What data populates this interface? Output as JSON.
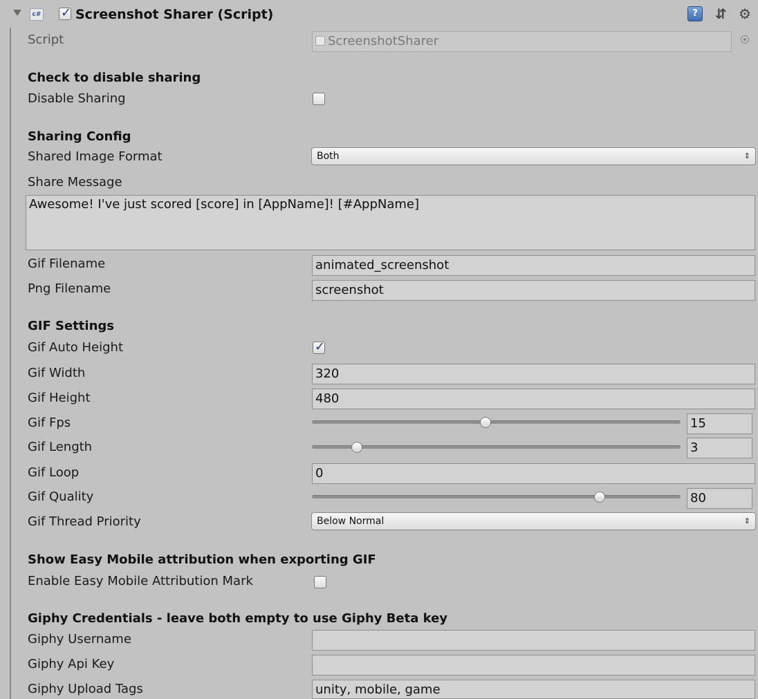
{
  "header": {
    "title": "Screenshot Sharer (Script)",
    "icon": "csharp-script-icon",
    "enabled": true
  },
  "script": {
    "label": "Script",
    "value": "ScreenshotSharer"
  },
  "sections": {
    "disable": "Check to disable sharing",
    "sharing": "Sharing Config",
    "gif": "GIF Settings",
    "attribution": "Show Easy Mobile attribution when exporting GIF",
    "giphy": "Giphy Credentials - leave both empty to use Giphy Beta key"
  },
  "disable_sharing": {
    "label": "Disable Sharing",
    "checked": false
  },
  "shared_image_format": {
    "label": "Shared Image Format",
    "value": "Both"
  },
  "share_message": {
    "label": "Share Message",
    "value": "Awesome! I've just scored [score] in [AppName]! [#AppName]"
  },
  "gif_filename": {
    "label": "Gif Filename",
    "value": "animated_screenshot"
  },
  "png_filename": {
    "label": "Png Filename",
    "value": "screenshot"
  },
  "gif_auto_height": {
    "label": "Gif Auto Height",
    "checked": true
  },
  "gif_width": {
    "label": "Gif Width",
    "value": "320"
  },
  "gif_height": {
    "label": "Gif Height",
    "value": "480"
  },
  "gif_fps": {
    "label": "Gif Fps",
    "value": "15",
    "fraction": 0.47
  },
  "gif_length": {
    "label": "Gif Length",
    "value": "3",
    "fraction": 0.11
  },
  "gif_loop": {
    "label": "Gif Loop",
    "value": "0"
  },
  "gif_quality": {
    "label": "Gif Quality",
    "value": "80",
    "fraction": 0.79
  },
  "gif_thread_priority": {
    "label": "Gif Thread Priority",
    "value": "Below Normal"
  },
  "attribution_mark": {
    "label": "Enable Easy Mobile Attribution Mark",
    "checked": false
  },
  "giphy_username": {
    "label": "Giphy Username",
    "value": ""
  },
  "giphy_api_key": {
    "label": "Giphy Api Key",
    "value": ""
  },
  "giphy_upload_tags": {
    "label": "Giphy Upload Tags",
    "value": "unity, mobile, game"
  }
}
